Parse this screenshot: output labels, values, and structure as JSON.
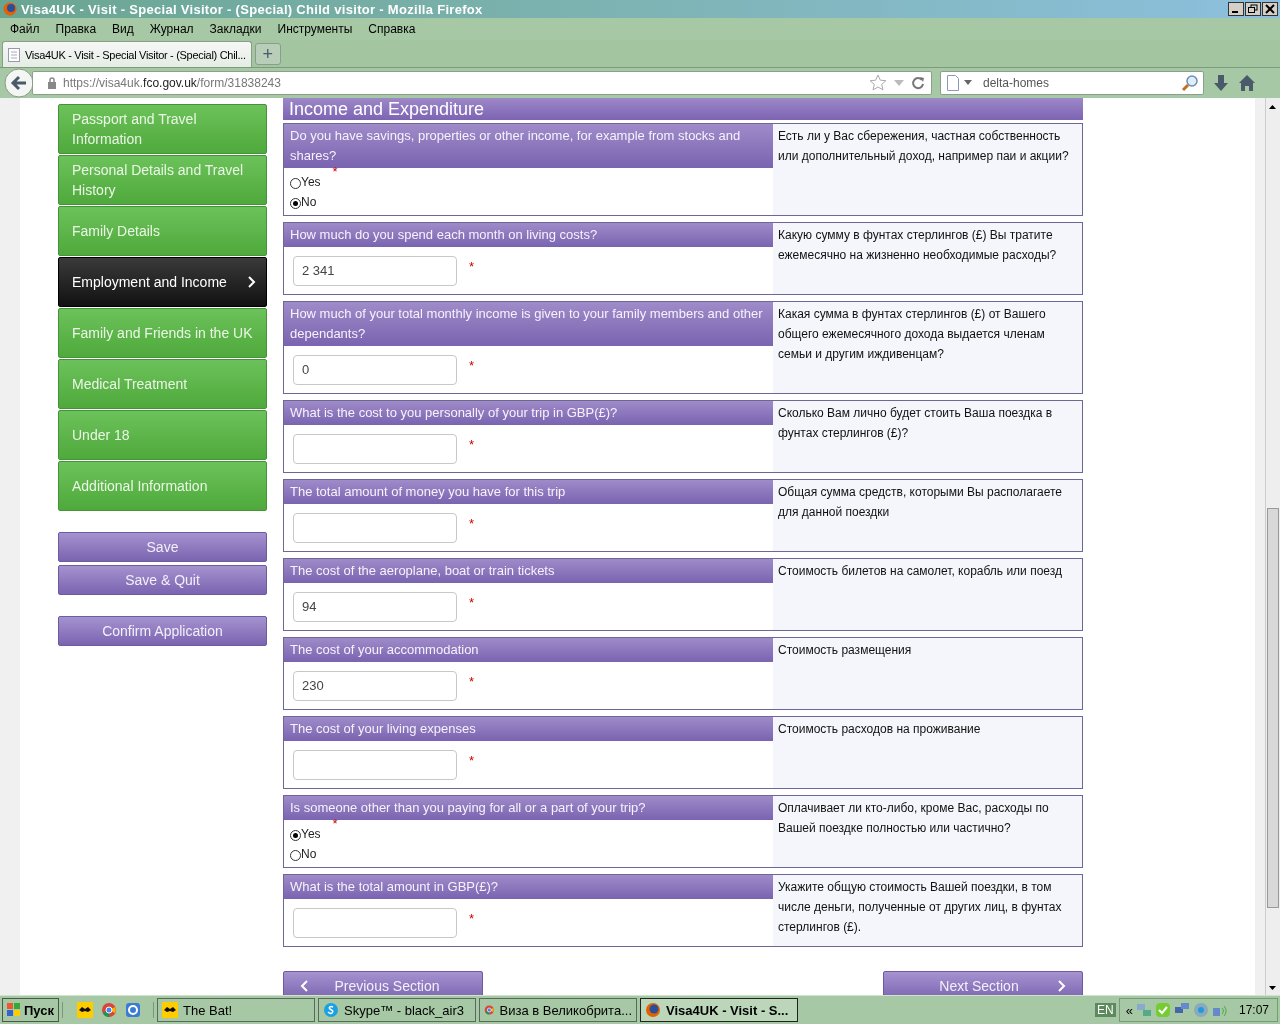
{
  "window": {
    "title": "Visa4UK - Visit - Special Visitor - (Special) Child visitor - Mozilla Firefox"
  },
  "menu": [
    "Файл",
    "Правка",
    "Вид",
    "Журнал",
    "Закладки",
    "Инструменты",
    "Справка"
  ],
  "tabs": [
    {
      "label": "Visa4UK - Visit - Special Visitor - (Special) Chil...",
      "selected": true
    }
  ],
  "new_tab": "+",
  "address": {
    "prefix": "https://visa4uk.",
    "host": "fco.gov.uk",
    "path": "/form/31838243"
  },
  "search": {
    "value": "delta-homes"
  },
  "sidebar": {
    "items": [
      {
        "label": "Passport and Travel Information",
        "selected": false
      },
      {
        "label": "Personal Details and Travel History",
        "selected": false
      },
      {
        "label": "Family Details",
        "selected": false
      },
      {
        "label": "Employment and Income",
        "selected": true
      },
      {
        "label": "Family and Friends in the UK",
        "selected": false
      },
      {
        "label": "Medical Treatment",
        "selected": false
      },
      {
        "label": "Under 18",
        "selected": false
      },
      {
        "label": "Additional Information",
        "selected": false
      }
    ],
    "buttons": [
      "Save",
      "Save & Quit"
    ],
    "confirm": "Confirm Application"
  },
  "section": {
    "title": "Income and Expenditure",
    "questions": [
      {
        "kind": "radio",
        "question": "Do you have savings, properties or other income, for example from stocks and shares?",
        "translation": "Есть ли у Вас сбережения, частная собственность или дополнительный доход, например паи и акции?",
        "required": "*",
        "options": [
          {
            "label": "Yes",
            "selected": false
          },
          {
            "label": "No",
            "selected": true
          }
        ]
      },
      {
        "kind": "text",
        "question": "How much do you spend each month on living costs?",
        "translation": "Какую сумму в фунтах стерлингов (£) Вы тратите ежемесячно на жизненно необходимые расходы?",
        "required": "*",
        "value": "2 341"
      },
      {
        "kind": "text",
        "question": "How much of your total monthly income is given to your family members and other dependants?",
        "translation": "Какая сумма в фунтах стерлингов (£) от Вашего общего ежемесячного дохода выдается членам семьи и другим иждивенцам?",
        "required": "*",
        "value": "0"
      },
      {
        "kind": "text",
        "question": "What is the cost to you personally of your trip in GBP(£)?",
        "translation": "Сколько Вам лично будет стоить Ваша поездка в фунтах стерлингов (£)?",
        "required": "*"
      },
      {
        "kind": "text",
        "question": "The total amount of money you have for this trip",
        "translation": "Общая сумма средств, которыми Вы располагаете для данной поездки",
        "required": "*"
      },
      {
        "kind": "text",
        "question": "The cost of the aeroplane, boat or train tickets",
        "translation": "Стоимость билетов на самолет, корабль или поезд",
        "required": "*",
        "value": "94"
      },
      {
        "kind": "text",
        "question": "The cost of your accommodation",
        "translation": "Стоимость размещения",
        "required": "*",
        "value": "230"
      },
      {
        "kind": "text",
        "question": "The cost of your living expenses",
        "translation": "Стоимость расходов на проживание",
        "required": "*"
      },
      {
        "kind": "radio",
        "question": "Is someone other than you paying for all or a part of your trip?",
        "translation": "Оплачивает ли кто-либо, кроме Вас, расходы по Вашей поездке полностью или частично?",
        "required": "*",
        "options": [
          {
            "label": "Yes",
            "selected": true
          },
          {
            "label": "No",
            "selected": false
          }
        ]
      },
      {
        "kind": "text",
        "question": "What is the total amount in GBP(£)?",
        "translation": "Укажите общую стоимость Вашей поездки, в том числе деньги, полученные от других лиц, в фунтах стерлингов (£).",
        "required": "*"
      }
    ]
  },
  "nav": {
    "previous": "Previous Section",
    "next": "Next Section"
  },
  "taskbar": {
    "start": "Пуск",
    "tasks": [
      {
        "label": "The Bat!",
        "selected": false
      },
      {
        "label": "Skype™ - black_air3",
        "selected": false
      },
      {
        "label": "Виза в Великобрита...",
        "selected": false
      },
      {
        "label": "Visa4UK - Visit - S...",
        "selected": true
      }
    ],
    "language": "EN",
    "expand": "«",
    "clock": "17:07"
  }
}
